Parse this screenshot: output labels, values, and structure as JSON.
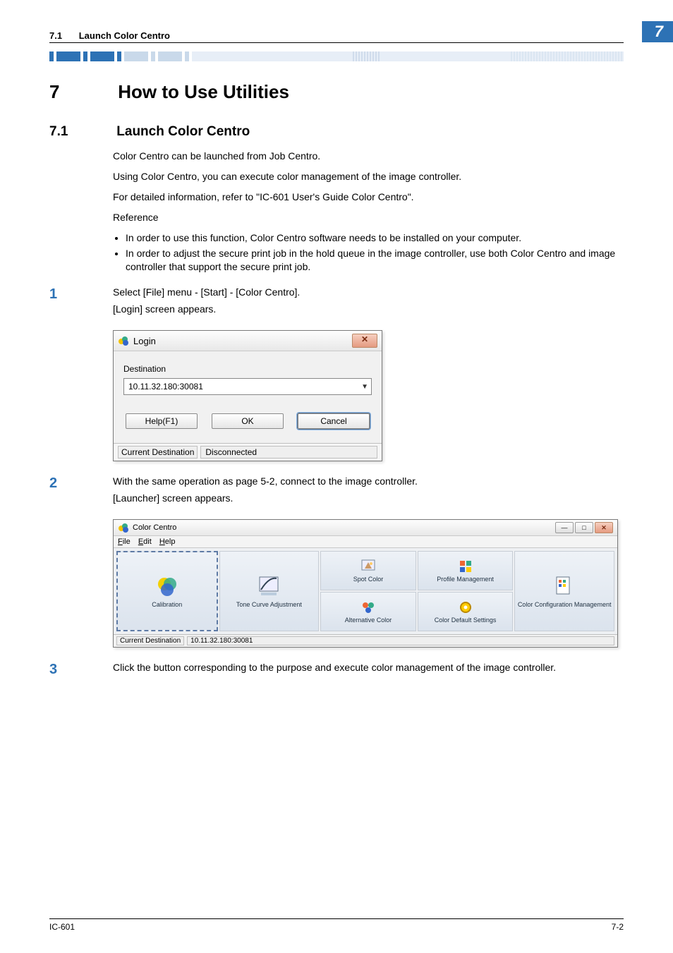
{
  "header": {
    "section_number": "7.1",
    "section_title": "Launch Color Centro",
    "chapter_tab": "7"
  },
  "chapter": {
    "number": "7",
    "title": "How to Use Utilities"
  },
  "section": {
    "number": "7.1",
    "title": "Launch Color Centro"
  },
  "intro": {
    "p1": "Color Centro can be launched from Job Centro.",
    "p2": "Using Color Centro, you can execute color management of the image controller.",
    "p3": "For detailed information, refer to \"IC-601 User's Guide Color Centro\".",
    "ref_label": "Reference",
    "bullets": [
      "In order to use this function, Color Centro software needs to be installed on your computer.",
      "In order to adjust the secure print job in the hold queue in the image controller, use both Color Centro and image controller that support the secure print job."
    ]
  },
  "steps": {
    "s1": {
      "num": "1",
      "text": "Select [File] menu - [Start] - [Color Centro].",
      "after": "[Login] screen appears."
    },
    "s2": {
      "num": "2",
      "text": "With the same operation as page 5-2, connect to the image controller.",
      "after": "[Launcher] screen appears."
    },
    "s3": {
      "num": "3",
      "text": "Click the button corresponding to the purpose and execute color management of the image controller."
    }
  },
  "login_dialog": {
    "title": "Login",
    "dest_label": "Destination",
    "dest_value": "10.11.32.180:30081",
    "help_btn": "Help(F1)",
    "ok_btn": "OK",
    "cancel_btn": "Cancel",
    "status_label": "Current Destination",
    "status_value": "Disconnected",
    "close_glyph": "✕"
  },
  "launcher": {
    "title": "Color Centro",
    "menu_file": "File",
    "menu_edit": "Edit",
    "menu_help": "Help",
    "cell_calibration": "Calibration",
    "cell_tone": "Tone Curve Adjustment",
    "cell_spot": "Spot Color",
    "cell_alt": "Alternative Color",
    "cell_profile": "Profile Management",
    "cell_defaults": "Color Default Settings",
    "cell_config": "Color Configuration Management",
    "status_label": "Current Destination",
    "status_value": "10.11.32.180:30081",
    "min_glyph": "—",
    "max_glyph": "□",
    "close_glyph": "✕"
  },
  "footer": {
    "left": "IC-601",
    "right": "7-2"
  }
}
